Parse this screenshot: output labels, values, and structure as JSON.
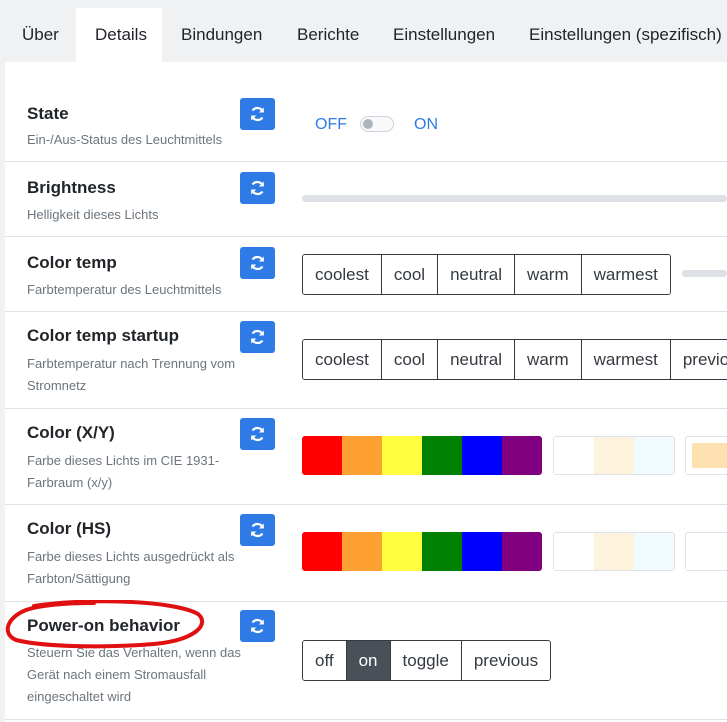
{
  "tabs": [
    {
      "label": "Über"
    },
    {
      "label": "Details"
    },
    {
      "label": "Bindungen"
    },
    {
      "label": "Berichte"
    },
    {
      "label": "Einstellungen"
    },
    {
      "label": "Einstellungen (spezifisch)"
    }
  ],
  "active_tab": "Details",
  "rows": {
    "state": {
      "label": "State",
      "description": "Ein-/Aus-Status des Leuchtmittels",
      "off_label": "OFF",
      "on_label": "ON",
      "value": "OFF"
    },
    "brightness": {
      "label": "Brightness",
      "description": "Helligkeit dieses Lichts"
    },
    "color_temp": {
      "label": "Color temp",
      "description": "Farbtemperatur des Leuchtmittels",
      "options": [
        "coolest",
        "cool",
        "neutral",
        "warm",
        "warmest"
      ]
    },
    "color_temp_startup": {
      "label": "Color temp startup",
      "description": "Farbtemperatur nach Trennung vom Stromnetz",
      "options": [
        "coolest",
        "cool",
        "neutral",
        "warm",
        "warmest",
        "previous"
      ]
    },
    "color_xy": {
      "label": "Color (X/Y)",
      "description": "Farbe dieses Lichts im CIE 1931-Farbraum (x/y)"
    },
    "color_hs": {
      "label": "Color (HS)",
      "description": "Farbe dieses Lichts ausgedrückt als Farbton/Sättigung"
    },
    "power_on": {
      "label": "Power-on behavior",
      "description": "Steuern Sie das Verhalten, wenn das Gerät nach einem Stromausfall eingeschaltet wird",
      "options": [
        "off",
        "on",
        "toggle",
        "previous"
      ],
      "selected": "on"
    }
  },
  "colors": {
    "accent": "#2f7be5",
    "rainbow": [
      "#ff0000",
      "#ffa033",
      "#ffff40",
      "#008000",
      "#0000ff",
      "#800080"
    ],
    "whites": [
      "#ffffff",
      "#fdf3dc",
      "#f1fbff"
    ],
    "warm_extra": "#fde0b0",
    "annotation": "#e01010"
  }
}
